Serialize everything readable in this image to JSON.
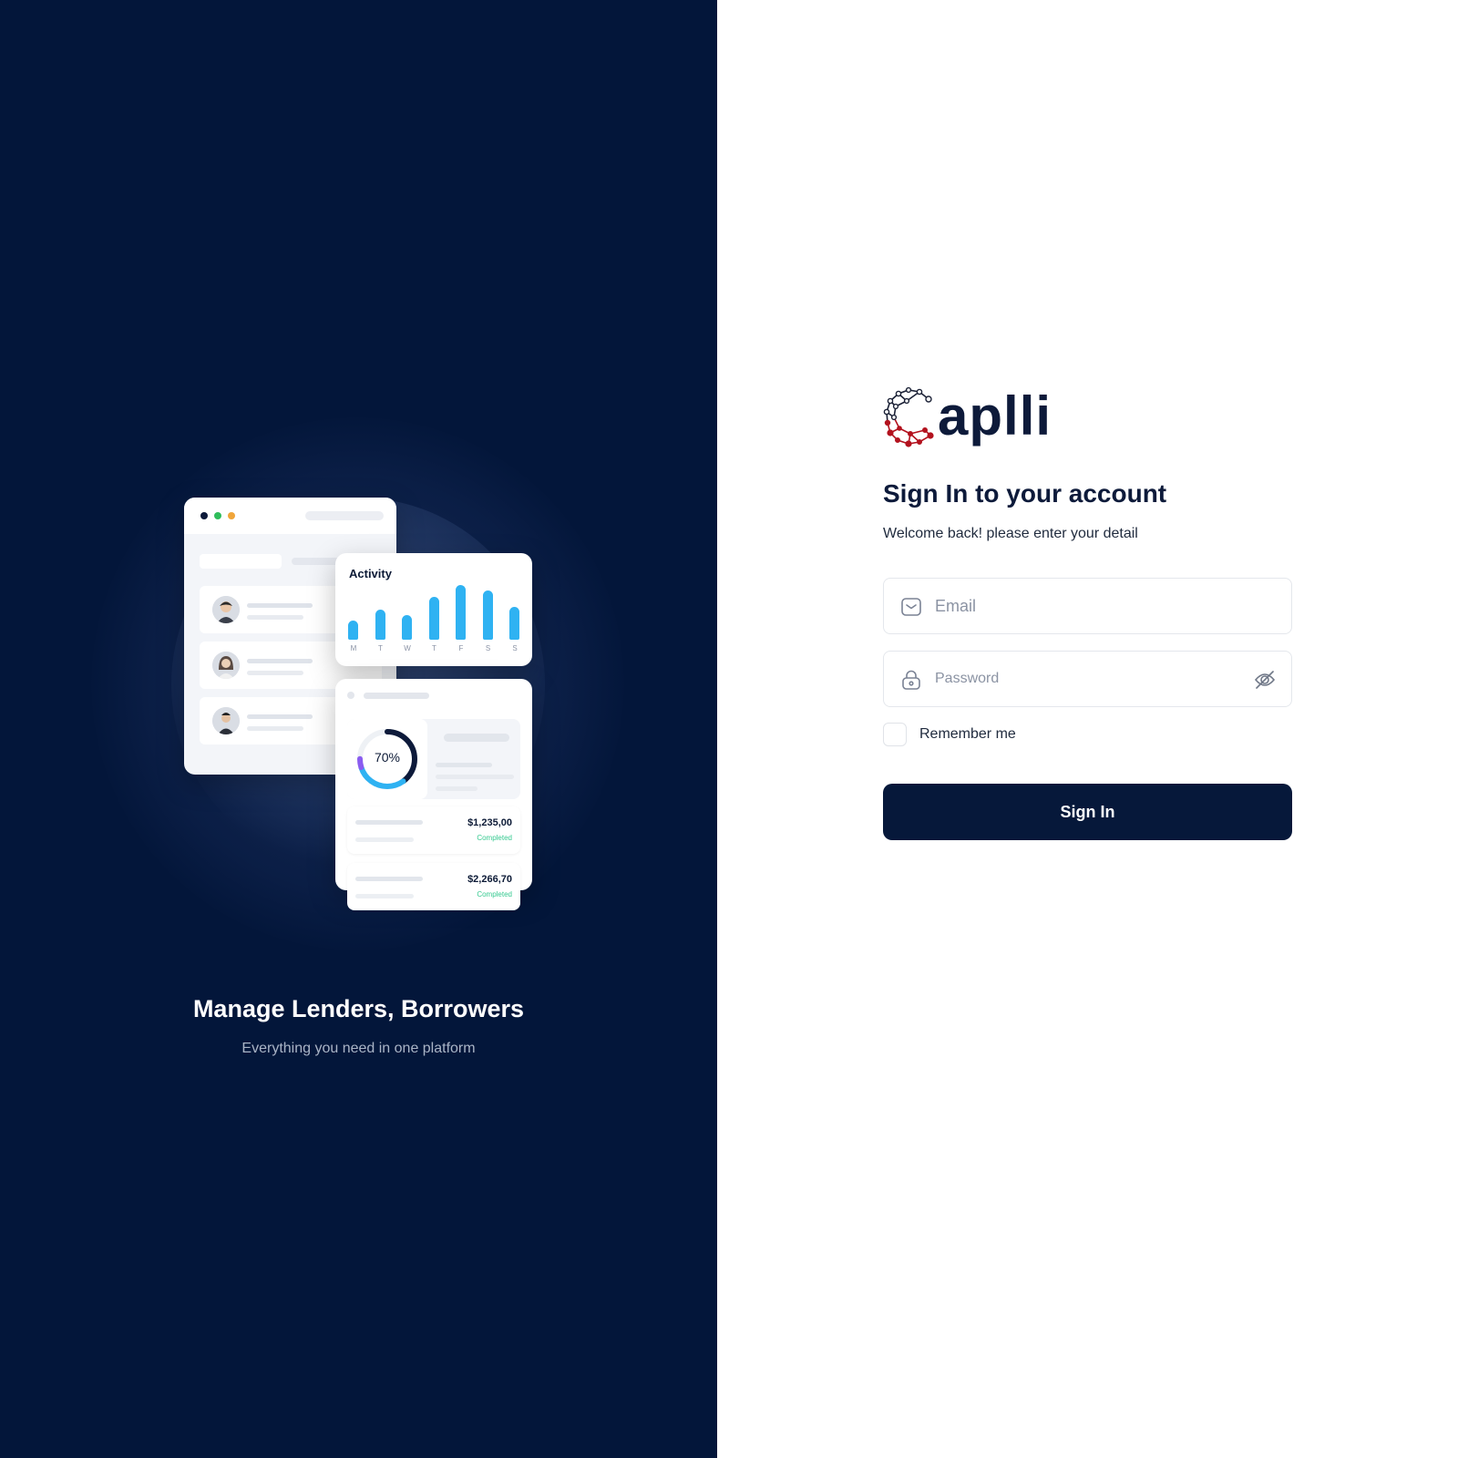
{
  "hero": {
    "title": "Manage Lenders, Borrowers",
    "subtitle": "Everything you need in one platform"
  },
  "illustration": {
    "activity_title": "Activity",
    "activity_bars": [
      {
        "label": "M",
        "value": 0.35
      },
      {
        "label": "T",
        "value": 0.55
      },
      {
        "label": "W",
        "value": 0.45
      },
      {
        "label": "T",
        "value": 0.78
      },
      {
        "label": "F",
        "value": 1.0
      },
      {
        "label": "S",
        "value": 0.9
      },
      {
        "label": "S",
        "value": 0.6
      }
    ],
    "donut_label": "70%",
    "donut_percent": 70,
    "transactions": [
      {
        "amount": "$1,235,00",
        "status": "Completed"
      },
      {
        "amount": "$2,266,70",
        "status": "Completed"
      }
    ]
  },
  "brand": {
    "name": "aplli",
    "colors": {
      "primary": "#06183a",
      "logo_accent": "#b3121e",
      "bar": "#2fb2f2",
      "status": "#34c98f"
    }
  },
  "form": {
    "title": "Sign In to your account",
    "subtitle": "Welcome back! please enter your detail",
    "email_placeholder": "Email",
    "email_value": "",
    "password_placeholder": "Password",
    "password_value": "",
    "remember_label": "Remember me",
    "remember_checked": false,
    "submit_label": "Sign In"
  },
  "icons": {
    "email": "mail-icon",
    "password": "lock-icon",
    "toggle_password": "eye-off-icon"
  }
}
